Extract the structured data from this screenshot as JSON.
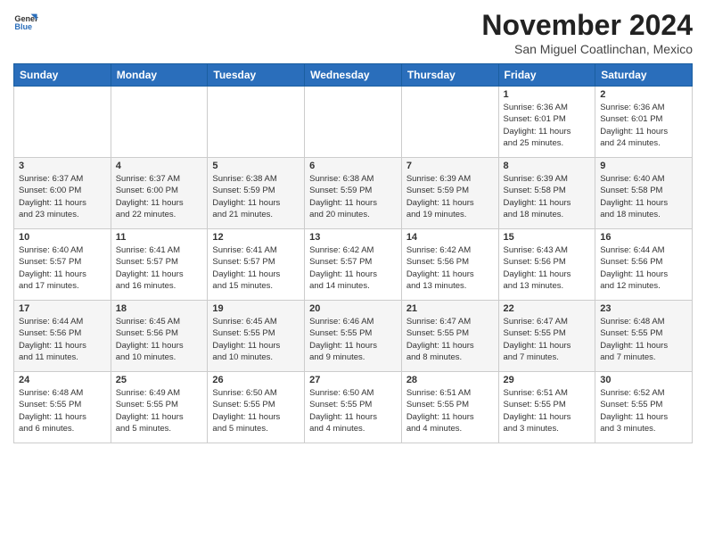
{
  "header": {
    "logo_general": "General",
    "logo_blue": "Blue",
    "month": "November 2024",
    "location": "San Miguel Coatlinchan, Mexico"
  },
  "weekdays": [
    "Sunday",
    "Monday",
    "Tuesday",
    "Wednesday",
    "Thursday",
    "Friday",
    "Saturday"
  ],
  "weeks": [
    [
      {
        "day": "",
        "info": ""
      },
      {
        "day": "",
        "info": ""
      },
      {
        "day": "",
        "info": ""
      },
      {
        "day": "",
        "info": ""
      },
      {
        "day": "",
        "info": ""
      },
      {
        "day": "1",
        "info": "Sunrise: 6:36 AM\nSunset: 6:01 PM\nDaylight: 11 hours\nand 25 minutes."
      },
      {
        "day": "2",
        "info": "Sunrise: 6:36 AM\nSunset: 6:01 PM\nDaylight: 11 hours\nand 24 minutes."
      }
    ],
    [
      {
        "day": "3",
        "info": "Sunrise: 6:37 AM\nSunset: 6:00 PM\nDaylight: 11 hours\nand 23 minutes."
      },
      {
        "day": "4",
        "info": "Sunrise: 6:37 AM\nSunset: 6:00 PM\nDaylight: 11 hours\nand 22 minutes."
      },
      {
        "day": "5",
        "info": "Sunrise: 6:38 AM\nSunset: 5:59 PM\nDaylight: 11 hours\nand 21 minutes."
      },
      {
        "day": "6",
        "info": "Sunrise: 6:38 AM\nSunset: 5:59 PM\nDaylight: 11 hours\nand 20 minutes."
      },
      {
        "day": "7",
        "info": "Sunrise: 6:39 AM\nSunset: 5:59 PM\nDaylight: 11 hours\nand 19 minutes."
      },
      {
        "day": "8",
        "info": "Sunrise: 6:39 AM\nSunset: 5:58 PM\nDaylight: 11 hours\nand 18 minutes."
      },
      {
        "day": "9",
        "info": "Sunrise: 6:40 AM\nSunset: 5:58 PM\nDaylight: 11 hours\nand 18 minutes."
      }
    ],
    [
      {
        "day": "10",
        "info": "Sunrise: 6:40 AM\nSunset: 5:57 PM\nDaylight: 11 hours\nand 17 minutes."
      },
      {
        "day": "11",
        "info": "Sunrise: 6:41 AM\nSunset: 5:57 PM\nDaylight: 11 hours\nand 16 minutes."
      },
      {
        "day": "12",
        "info": "Sunrise: 6:41 AM\nSunset: 5:57 PM\nDaylight: 11 hours\nand 15 minutes."
      },
      {
        "day": "13",
        "info": "Sunrise: 6:42 AM\nSunset: 5:57 PM\nDaylight: 11 hours\nand 14 minutes."
      },
      {
        "day": "14",
        "info": "Sunrise: 6:42 AM\nSunset: 5:56 PM\nDaylight: 11 hours\nand 13 minutes."
      },
      {
        "day": "15",
        "info": "Sunrise: 6:43 AM\nSunset: 5:56 PM\nDaylight: 11 hours\nand 13 minutes."
      },
      {
        "day": "16",
        "info": "Sunrise: 6:44 AM\nSunset: 5:56 PM\nDaylight: 11 hours\nand 12 minutes."
      }
    ],
    [
      {
        "day": "17",
        "info": "Sunrise: 6:44 AM\nSunset: 5:56 PM\nDaylight: 11 hours\nand 11 minutes."
      },
      {
        "day": "18",
        "info": "Sunrise: 6:45 AM\nSunset: 5:56 PM\nDaylight: 11 hours\nand 10 minutes."
      },
      {
        "day": "19",
        "info": "Sunrise: 6:45 AM\nSunset: 5:55 PM\nDaylight: 11 hours\nand 10 minutes."
      },
      {
        "day": "20",
        "info": "Sunrise: 6:46 AM\nSunset: 5:55 PM\nDaylight: 11 hours\nand 9 minutes."
      },
      {
        "day": "21",
        "info": "Sunrise: 6:47 AM\nSunset: 5:55 PM\nDaylight: 11 hours\nand 8 minutes."
      },
      {
        "day": "22",
        "info": "Sunrise: 6:47 AM\nSunset: 5:55 PM\nDaylight: 11 hours\nand 7 minutes."
      },
      {
        "day": "23",
        "info": "Sunrise: 6:48 AM\nSunset: 5:55 PM\nDaylight: 11 hours\nand 7 minutes."
      }
    ],
    [
      {
        "day": "24",
        "info": "Sunrise: 6:48 AM\nSunset: 5:55 PM\nDaylight: 11 hours\nand 6 minutes."
      },
      {
        "day": "25",
        "info": "Sunrise: 6:49 AM\nSunset: 5:55 PM\nDaylight: 11 hours\nand 5 minutes."
      },
      {
        "day": "26",
        "info": "Sunrise: 6:50 AM\nSunset: 5:55 PM\nDaylight: 11 hours\nand 5 minutes."
      },
      {
        "day": "27",
        "info": "Sunrise: 6:50 AM\nSunset: 5:55 PM\nDaylight: 11 hours\nand 4 minutes."
      },
      {
        "day": "28",
        "info": "Sunrise: 6:51 AM\nSunset: 5:55 PM\nDaylight: 11 hours\nand 4 minutes."
      },
      {
        "day": "29",
        "info": "Sunrise: 6:51 AM\nSunset: 5:55 PM\nDaylight: 11 hours\nand 3 minutes."
      },
      {
        "day": "30",
        "info": "Sunrise: 6:52 AM\nSunset: 5:55 PM\nDaylight: 11 hours\nand 3 minutes."
      }
    ]
  ]
}
